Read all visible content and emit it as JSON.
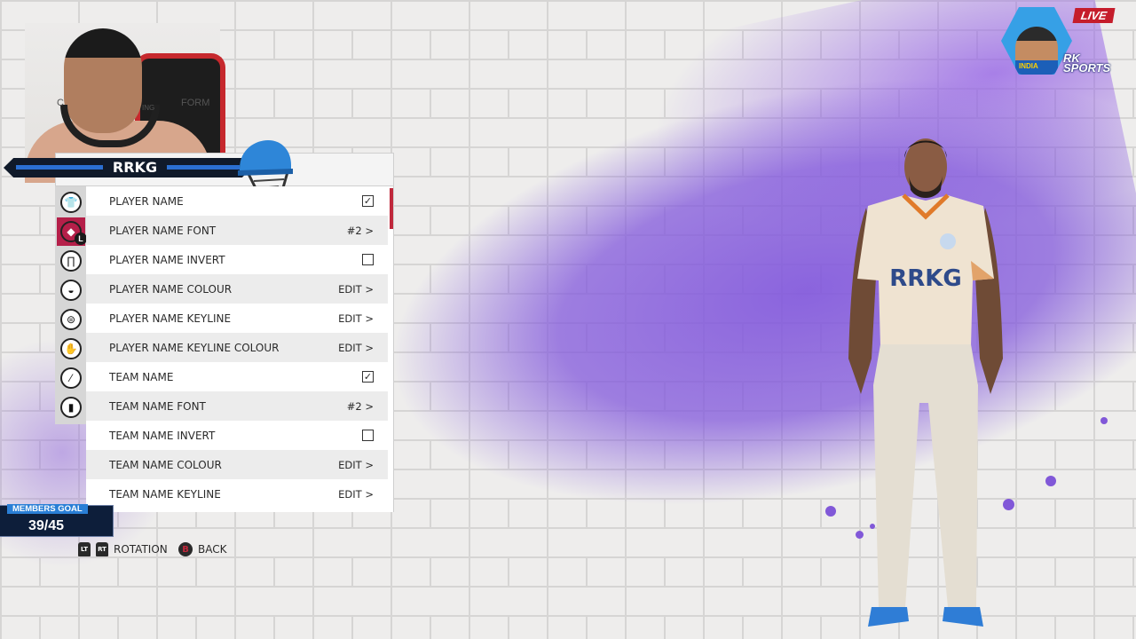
{
  "stream": {
    "live_label": "LIVE",
    "brand_line1": "RK",
    "brand_line2": "SPORTS",
    "badge_text": "INDIA",
    "cam_text_left": "C",
    "cam_text_mid": "ING",
    "cam_text_right": "FORM"
  },
  "nameplate": {
    "team": "RRKG"
  },
  "menu": {
    "category_icons": [
      {
        "name": "shirt-icon",
        "active": false
      },
      {
        "name": "logo-badge-icon",
        "active": true,
        "badge": "L"
      },
      {
        "name": "trousers-icon",
        "active": false
      },
      {
        "name": "cap-icon",
        "active": false
      },
      {
        "name": "helmet-icon",
        "active": false
      },
      {
        "name": "glove-icon",
        "active": false
      },
      {
        "name": "bat-icon",
        "active": false
      },
      {
        "name": "pad-icon",
        "active": false
      }
    ],
    "rows": [
      {
        "label": "PLAYER NAME",
        "type": "checkbox",
        "checked": true
      },
      {
        "label": "PLAYER NAME FONT",
        "type": "value",
        "value": "#2 >"
      },
      {
        "label": "PLAYER NAME INVERT",
        "type": "checkbox",
        "checked": false
      },
      {
        "label": "PLAYER NAME COLOUR",
        "type": "value",
        "value": "EDIT >"
      },
      {
        "label": "PLAYER NAME KEYLINE",
        "type": "value",
        "value": "EDIT >"
      },
      {
        "label": "PLAYER NAME KEYLINE COLOUR",
        "type": "value",
        "value": "EDIT >"
      },
      {
        "label": "TEAM NAME",
        "type": "checkbox",
        "checked": true
      },
      {
        "label": "TEAM NAME FONT",
        "type": "value",
        "value": "#2 >"
      },
      {
        "label": "TEAM NAME INVERT",
        "type": "checkbox",
        "checked": false
      },
      {
        "label": "TEAM NAME COLOUR",
        "type": "value",
        "value": "EDIT >"
      },
      {
        "label": "TEAM NAME KEYLINE",
        "type": "value",
        "value": "EDIT >"
      }
    ],
    "check_mark": "✓"
  },
  "members_goal": {
    "label": "MEMBERS GOAL",
    "value": "39/45"
  },
  "controls": {
    "lt": "LT",
    "rt": "RT",
    "rotation_label": "ROTATION",
    "b": "B",
    "back_label": "BACK"
  },
  "player": {
    "jersey_text": "RRKG"
  },
  "colors": {
    "accent": "#b51f49",
    "splash": "#8158d8",
    "panel_row_alt": "#ececec"
  }
}
